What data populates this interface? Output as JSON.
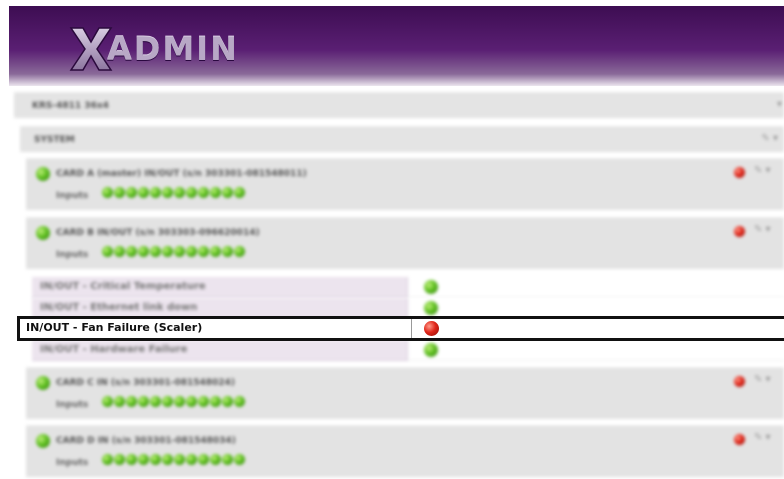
{
  "header": {
    "logo_text": "ADMIN"
  },
  "device": {
    "title": "KRS-4811 36x4"
  },
  "system": {
    "label": "SYSTEM"
  },
  "cards": [
    {
      "title": "CARD A (master) IN/OUT (s/n 303301-081548011)",
      "inputs_label": "Inputs",
      "status": "ok",
      "alarm": true
    },
    {
      "title": "CARD B IN/OUT (s/n 303303-096620014)",
      "inputs_label": "Inputs",
      "status": "ok",
      "alarm": true
    },
    {
      "title": "CARD C IN (s/n 303301-081548024)",
      "inputs_label": "Inputs",
      "status": "ok",
      "alarm": true
    },
    {
      "title": "CARD D IN (s/n 303301-081548034)",
      "inputs_label": "Inputs",
      "status": "ok",
      "alarm": true
    }
  ],
  "alarms": [
    {
      "label": "IN/OUT - Critical Temperature",
      "status": "ok"
    },
    {
      "label": "IN/OUT - Ethernet link down",
      "status": "ok"
    },
    {
      "label": "IN/OUT - Fan Failure (Scaler)",
      "status": "error"
    },
    {
      "label": "IN/OUT - Hardware Failure",
      "status": "ok"
    }
  ],
  "colors": {
    "header": "#4a1463",
    "ok": "#5fbf21",
    "error": "#e0261a",
    "highlight_border": "#111111"
  }
}
